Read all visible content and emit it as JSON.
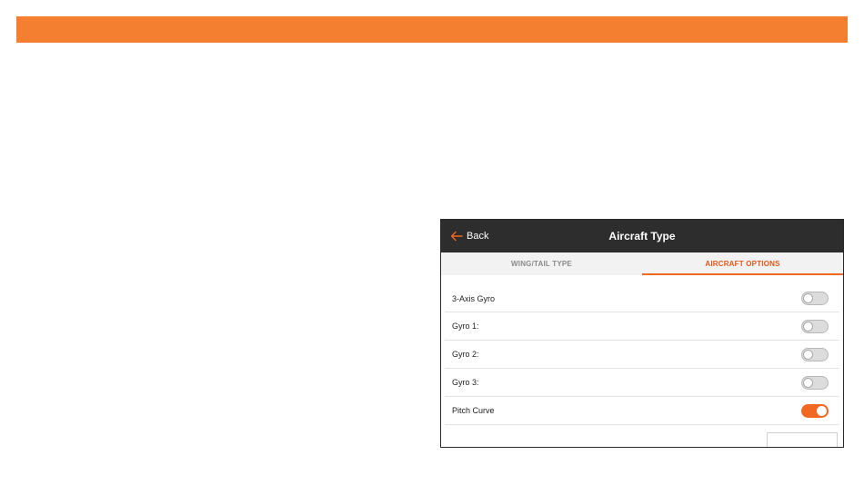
{
  "colors": {
    "banner": "#f47f30",
    "title_bar": "#2d2d2d",
    "accent": "#f26722"
  },
  "header": {
    "back_label": "Back",
    "back_icon": "arrow-left-icon",
    "title": "Aircraft Type"
  },
  "tabs": [
    {
      "label": "WING/TAIL TYPE",
      "active": false
    },
    {
      "label": "AIRCRAFT OPTIONS",
      "active": true
    }
  ],
  "options": [
    {
      "label": "3-Axis Gyro",
      "enabled": false
    },
    {
      "label": "Gyro 1:",
      "enabled": false
    },
    {
      "label": "Gyro 2:",
      "enabled": false
    },
    {
      "label": "Gyro 3:",
      "enabled": false
    },
    {
      "label": "Pitch Curve",
      "enabled": true
    }
  ]
}
